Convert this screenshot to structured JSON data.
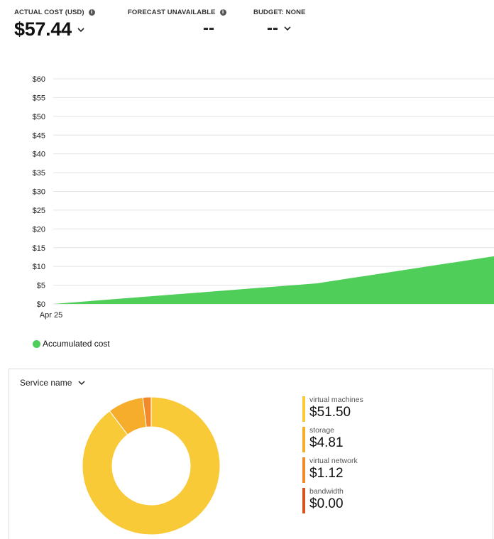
{
  "kpis": {
    "actual": {
      "label": "ACTUAL COST (USD)",
      "value": "$57.44"
    },
    "forecast": {
      "label": "FORECAST UNAVAILABLE",
      "value": "--"
    },
    "budget": {
      "label": "BUDGET: NONE",
      "value": "--"
    }
  },
  "icons": {
    "info": "info-icon",
    "dropdown": "chevron-down-icon"
  },
  "colors": {
    "accumulated": "#4fce5a",
    "virtual_machines": "#f9ca38",
    "storage": "#f6ad2c",
    "virtual_network": "#f08a2b",
    "bandwidth": "#d9531e"
  },
  "chart_data": {
    "type": "area",
    "y_ticks": [
      "$60",
      "$55",
      "$50",
      "$45",
      "$40",
      "$35",
      "$30",
      "$25",
      "$20",
      "$15",
      "$10",
      "$5",
      "$0"
    ],
    "ylim": [
      0,
      60
    ],
    "x_tick_labels": [
      "Apr 25"
    ],
    "grid": true,
    "legend_position": "bottom-left",
    "series": [
      {
        "name": "Accumulated cost",
        "points": [
          {
            "x": 0,
            "y": 0
          },
          {
            "x": 7,
            "y": 5.5
          },
          {
            "x": 11.7,
            "y": 12.7
          }
        ]
      }
    ],
    "x_range": [
      0,
      11.7
    ]
  },
  "breakdown": {
    "selector_label": "Service name",
    "items": [
      {
        "name": "virtual machines",
        "value": "$51.50",
        "amount": 51.5,
        "key": "virtual_machines"
      },
      {
        "name": "storage",
        "value": "$4.81",
        "amount": 4.81,
        "key": "storage"
      },
      {
        "name": "virtual network",
        "value": "$1.12",
        "amount": 1.12,
        "key": "virtual_network"
      },
      {
        "name": "bandwidth",
        "value": "$0.00",
        "amount": 0.0,
        "key": "bandwidth"
      }
    ]
  }
}
